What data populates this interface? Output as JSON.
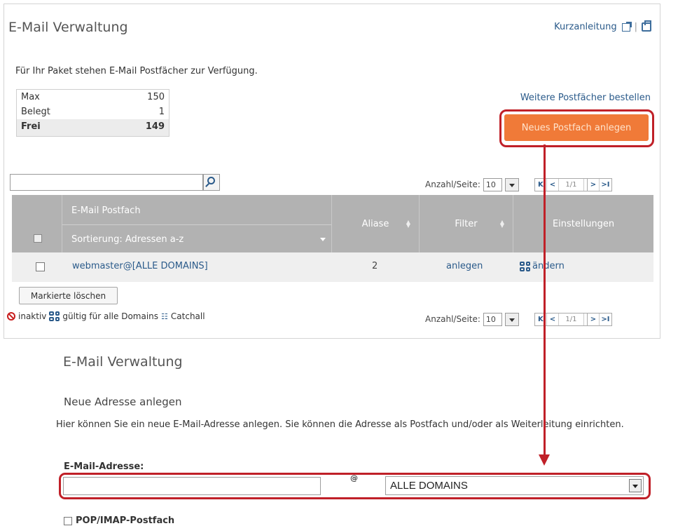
{
  "top": {
    "title": "E-Mail Verwaltung",
    "quick_guide": "Kurzanleitung",
    "intro": "Für Ihr Paket stehen E-Mail Postfächer zur Verfügung.",
    "stats": [
      {
        "label": "Max",
        "value": "150"
      },
      {
        "label": "Belegt",
        "value": "1"
      },
      {
        "label": "Frei",
        "value": "149"
      }
    ],
    "more_link": "Weitere Postfächer bestellen",
    "new_button": "Neues Postfach anlegen",
    "pager": {
      "label": "Anzahl/Seite:",
      "per_page": "10",
      "page": "1/1",
      "first": "K",
      "prev": "<",
      "next": ">",
      "last": ">I"
    },
    "grid": {
      "headers": {
        "mail": "E-Mail Postfach",
        "sort": "Sortierung: Adressen a-z",
        "aliase": "Aliase",
        "filter": "Filter",
        "settings": "Einstellungen"
      },
      "row": {
        "address": "webmaster@[ALLE DOMAINS]",
        "aliase": "2",
        "filter": "anlegen",
        "settings": "ändern"
      }
    },
    "delete_button": "Markierte löschen",
    "legend": {
      "inactive": "inaktiv",
      "all_domains": "gültig für alle Domains",
      "catchall": "Catchall"
    }
  },
  "bottom": {
    "title": "E-Mail Verwaltung",
    "subtitle": "Neue Adresse anlegen",
    "description": "Hier können Sie ein neue E-Mail-Adresse anlegen. Sie können die Adresse als Postfach und/oder als Weiterleitung einrichten.",
    "field_label": "E-Mail-Adresse:",
    "at": "@",
    "domain_value": "ALLE DOMAINS",
    "pop_label": "POP/IMAP-Postfach"
  },
  "colors": {
    "accent": "#f07a38",
    "highlight": "#c02028",
    "link": "#2a5a8a",
    "header": "#b2b2b2"
  }
}
